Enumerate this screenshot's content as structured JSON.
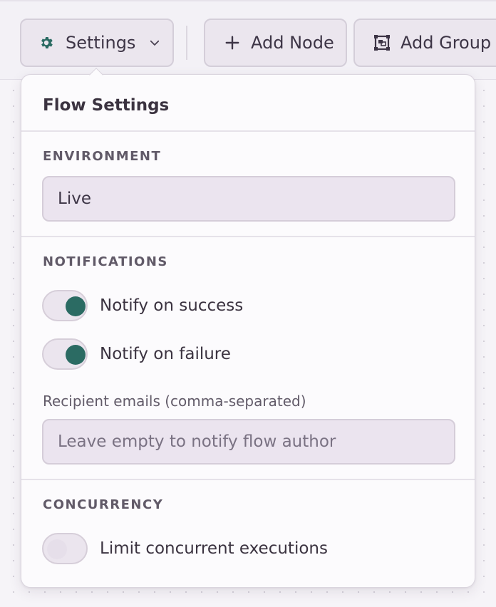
{
  "toolbar": {
    "settings_label": "Settings",
    "add_node_label": "Add Node",
    "add_group_label": "Add Group"
  },
  "panel": {
    "title": "Flow Settings",
    "environment": {
      "heading": "ENVIRONMENT",
      "value": "Live"
    },
    "notifications": {
      "heading": "NOTIFICATIONS",
      "notify_success": {
        "label": "Notify on success",
        "enabled": true
      },
      "notify_failure": {
        "label": "Notify on failure",
        "enabled": true
      },
      "recipients_label": "Recipient emails (comma-separated)",
      "recipients_value": "",
      "recipients_placeholder": "Leave empty to notify flow author"
    },
    "concurrency": {
      "heading": "CONCURRENCY",
      "limit": {
        "label": "Limit concurrent executions",
        "enabled": false
      }
    }
  },
  "colors": {
    "accent": "#2b6b63",
    "field_bg": "#ebe4ef",
    "panel_bg": "#fcfbfd"
  },
  "icons": [
    "gear-icon",
    "chevron-down-icon",
    "plus-icon",
    "group-icon"
  ]
}
